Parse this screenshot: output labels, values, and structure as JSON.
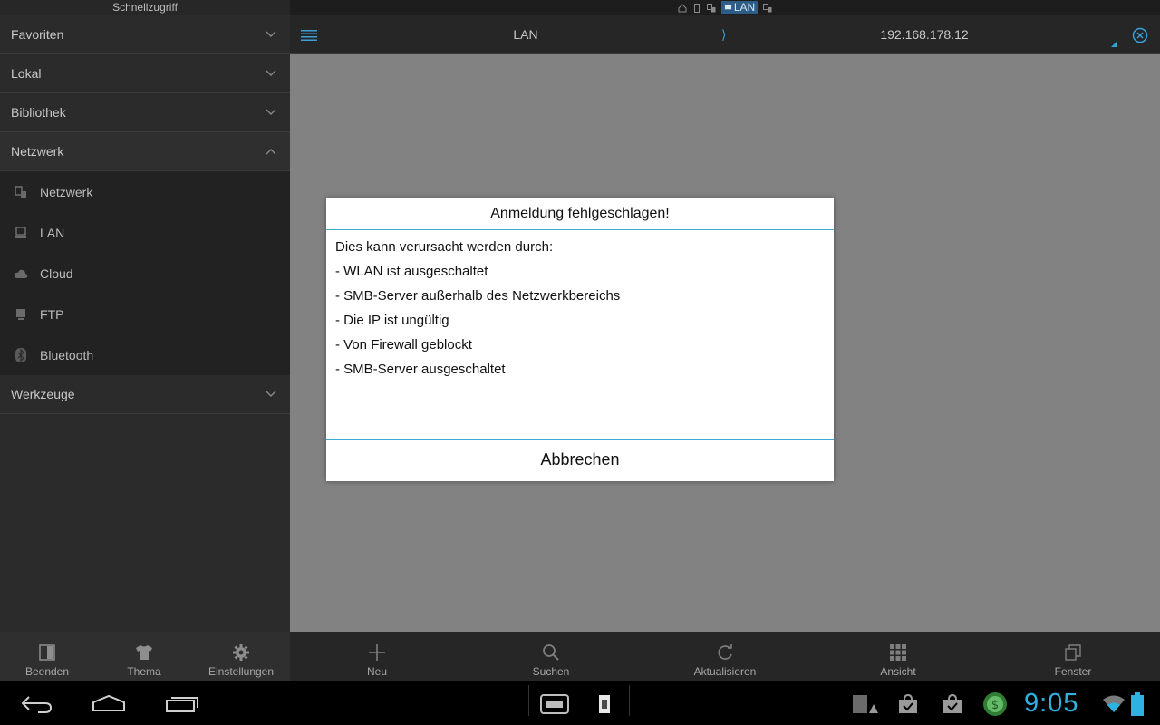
{
  "sidebar": {
    "title": "Schnellzugriff",
    "sections": {
      "favoriten": "Favoriten",
      "lokal": "Lokal",
      "bibliothek": "Bibliothek",
      "netzwerk": "Netzwerk",
      "werkzeuge": "Werkzeuge"
    },
    "network_items": [
      "Netzwerk",
      "LAN",
      "Cloud",
      "FTP",
      "Bluetooth"
    ]
  },
  "status_strip": {
    "active_tab": "LAN"
  },
  "path_bar": {
    "crumb1": "LAN",
    "separator": "⟩",
    "crumb2": "192.168.178.12"
  },
  "toolbar": {
    "left": [
      "Beenden",
      "Thema",
      "Einstellungen"
    ],
    "right": [
      "Neu",
      "Suchen",
      "Aktualisieren",
      "Ansicht",
      "Fenster"
    ]
  },
  "dialog": {
    "title": "Anmeldung fehlgeschlagen!",
    "lines": [
      "Dies kann verursacht werden durch:",
      "- WLAN ist ausgeschaltet",
      "- SMB-Server außerhalb des Netzwerkbereichs",
      "- Die IP ist ungültig",
      "- Von Firewall geblockt",
      "- SMB-Server ausgeschaltet"
    ],
    "cancel": "Abbrechen"
  },
  "system": {
    "clock": "9:05"
  },
  "colors": {
    "accent": "#2fb2e2",
    "dialog_divider": "#3ea8d8",
    "content_bg": "#828282"
  }
}
